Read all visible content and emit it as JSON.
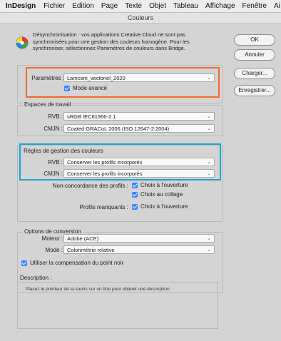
{
  "menubar": {
    "app": "InDesign",
    "items": [
      "Fichier",
      "Edition",
      "Page",
      "Texte",
      "Objet",
      "Tableau",
      "Affichage",
      "Fenêtre",
      "Ai"
    ]
  },
  "dialog": {
    "title": "Couleurs",
    "sync_message": "Désynchronisation : vos applications Creative Cloud ne sont pas synchronisées pour une gestion des couleurs homogène. Pour les synchroniser, sélectionnez Paramètres de couleurs dans Bridge.",
    "buttons": {
      "ok": "OK",
      "cancel": "Annuler",
      "load": "Charger...",
      "save": "Enregistrer..."
    },
    "settings": {
      "label": "Paramètres :",
      "value": "Lamcom_vectoriel_2020",
      "advanced_mode": "Mode avancé"
    },
    "working_spaces": {
      "title": "Espaces de travail",
      "rgb_label": "RVB :",
      "rgb_value": "sRGB IEC61966-2.1",
      "cmyk_label": "CMJN :",
      "cmyk_value": "Coated GRACoL 2006 (ISO 12647-2:2004)"
    },
    "color_management": {
      "title": "Règles de gestion des couleurs",
      "rgb_label": "RVB :",
      "rgb_value": "Conserver les profils incorporés",
      "cmyk_label": "CMJN :",
      "cmyk_value": "Conserver les profils incorporés",
      "mismatch_label": "Non-concordance des profils :",
      "ask_opening": "Choix à l'ouverture",
      "ask_pasting": "Choix au collage",
      "missing_label": "Profils manquants :",
      "missing_ask_opening": "Choix à l'ouverture"
    },
    "conversion": {
      "title": "Options de conversion",
      "engine_label": "Moteur :",
      "engine_value": "Adobe (ACE)",
      "intent_label": "Mode :",
      "intent_value": "Colorimétrie relative",
      "black_point": "Utiliser la compensation du point noir"
    },
    "description": {
      "title": "Description :",
      "text": "Placez le pointeur de la souris sur un titre pour obtenir une description."
    }
  },
  "colors": {
    "highlight_orange": "#ef6a2a",
    "highlight_blue": "#18a3dc",
    "checkbox": "#3b82f6"
  }
}
